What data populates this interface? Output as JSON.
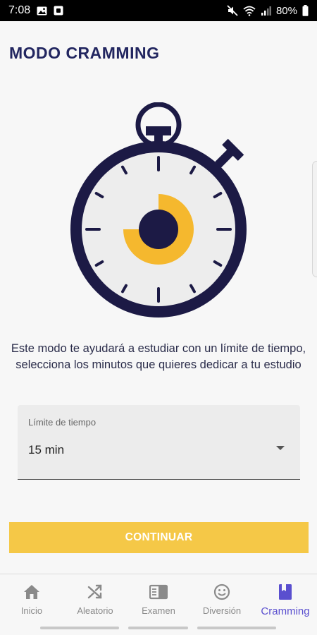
{
  "status_bar": {
    "time": "7:08",
    "battery": "80%",
    "icons": [
      "image-icon",
      "screenshot-icon",
      "mute-icon",
      "wifi-icon",
      "signal-icon",
      "battery-icon"
    ]
  },
  "page": {
    "title": "MODO CRAMMING",
    "description": "Este modo te ayudará a estudiar con un límite de tiempo, selecciona los minutos que quieres dedicar a tu estudio"
  },
  "illustration": {
    "icon": "stopwatch-icon",
    "colors": {
      "navy": "#1c1a45",
      "accent": "#f5b82e",
      "face": "#ededed"
    },
    "progress_fraction": 0.75
  },
  "time_select": {
    "label": "Límite de tiempo",
    "value": "15 min"
  },
  "continue_button": {
    "label": "CONTINUAR",
    "color": "#f5c847"
  },
  "bottom_nav": {
    "items": [
      {
        "label": "Inicio",
        "icon": "home-icon",
        "active": false
      },
      {
        "label": "Aleatorio",
        "icon": "shuffle-icon",
        "active": false
      },
      {
        "label": "Examen",
        "icon": "book-open-icon",
        "active": false
      },
      {
        "label": "Diversión",
        "icon": "smile-icon",
        "active": false
      },
      {
        "label": "Cramming",
        "icon": "bookmark-book-icon",
        "active": true
      }
    ],
    "active_color": "#5a4fcf",
    "inactive_color": "#8a8a8a"
  }
}
